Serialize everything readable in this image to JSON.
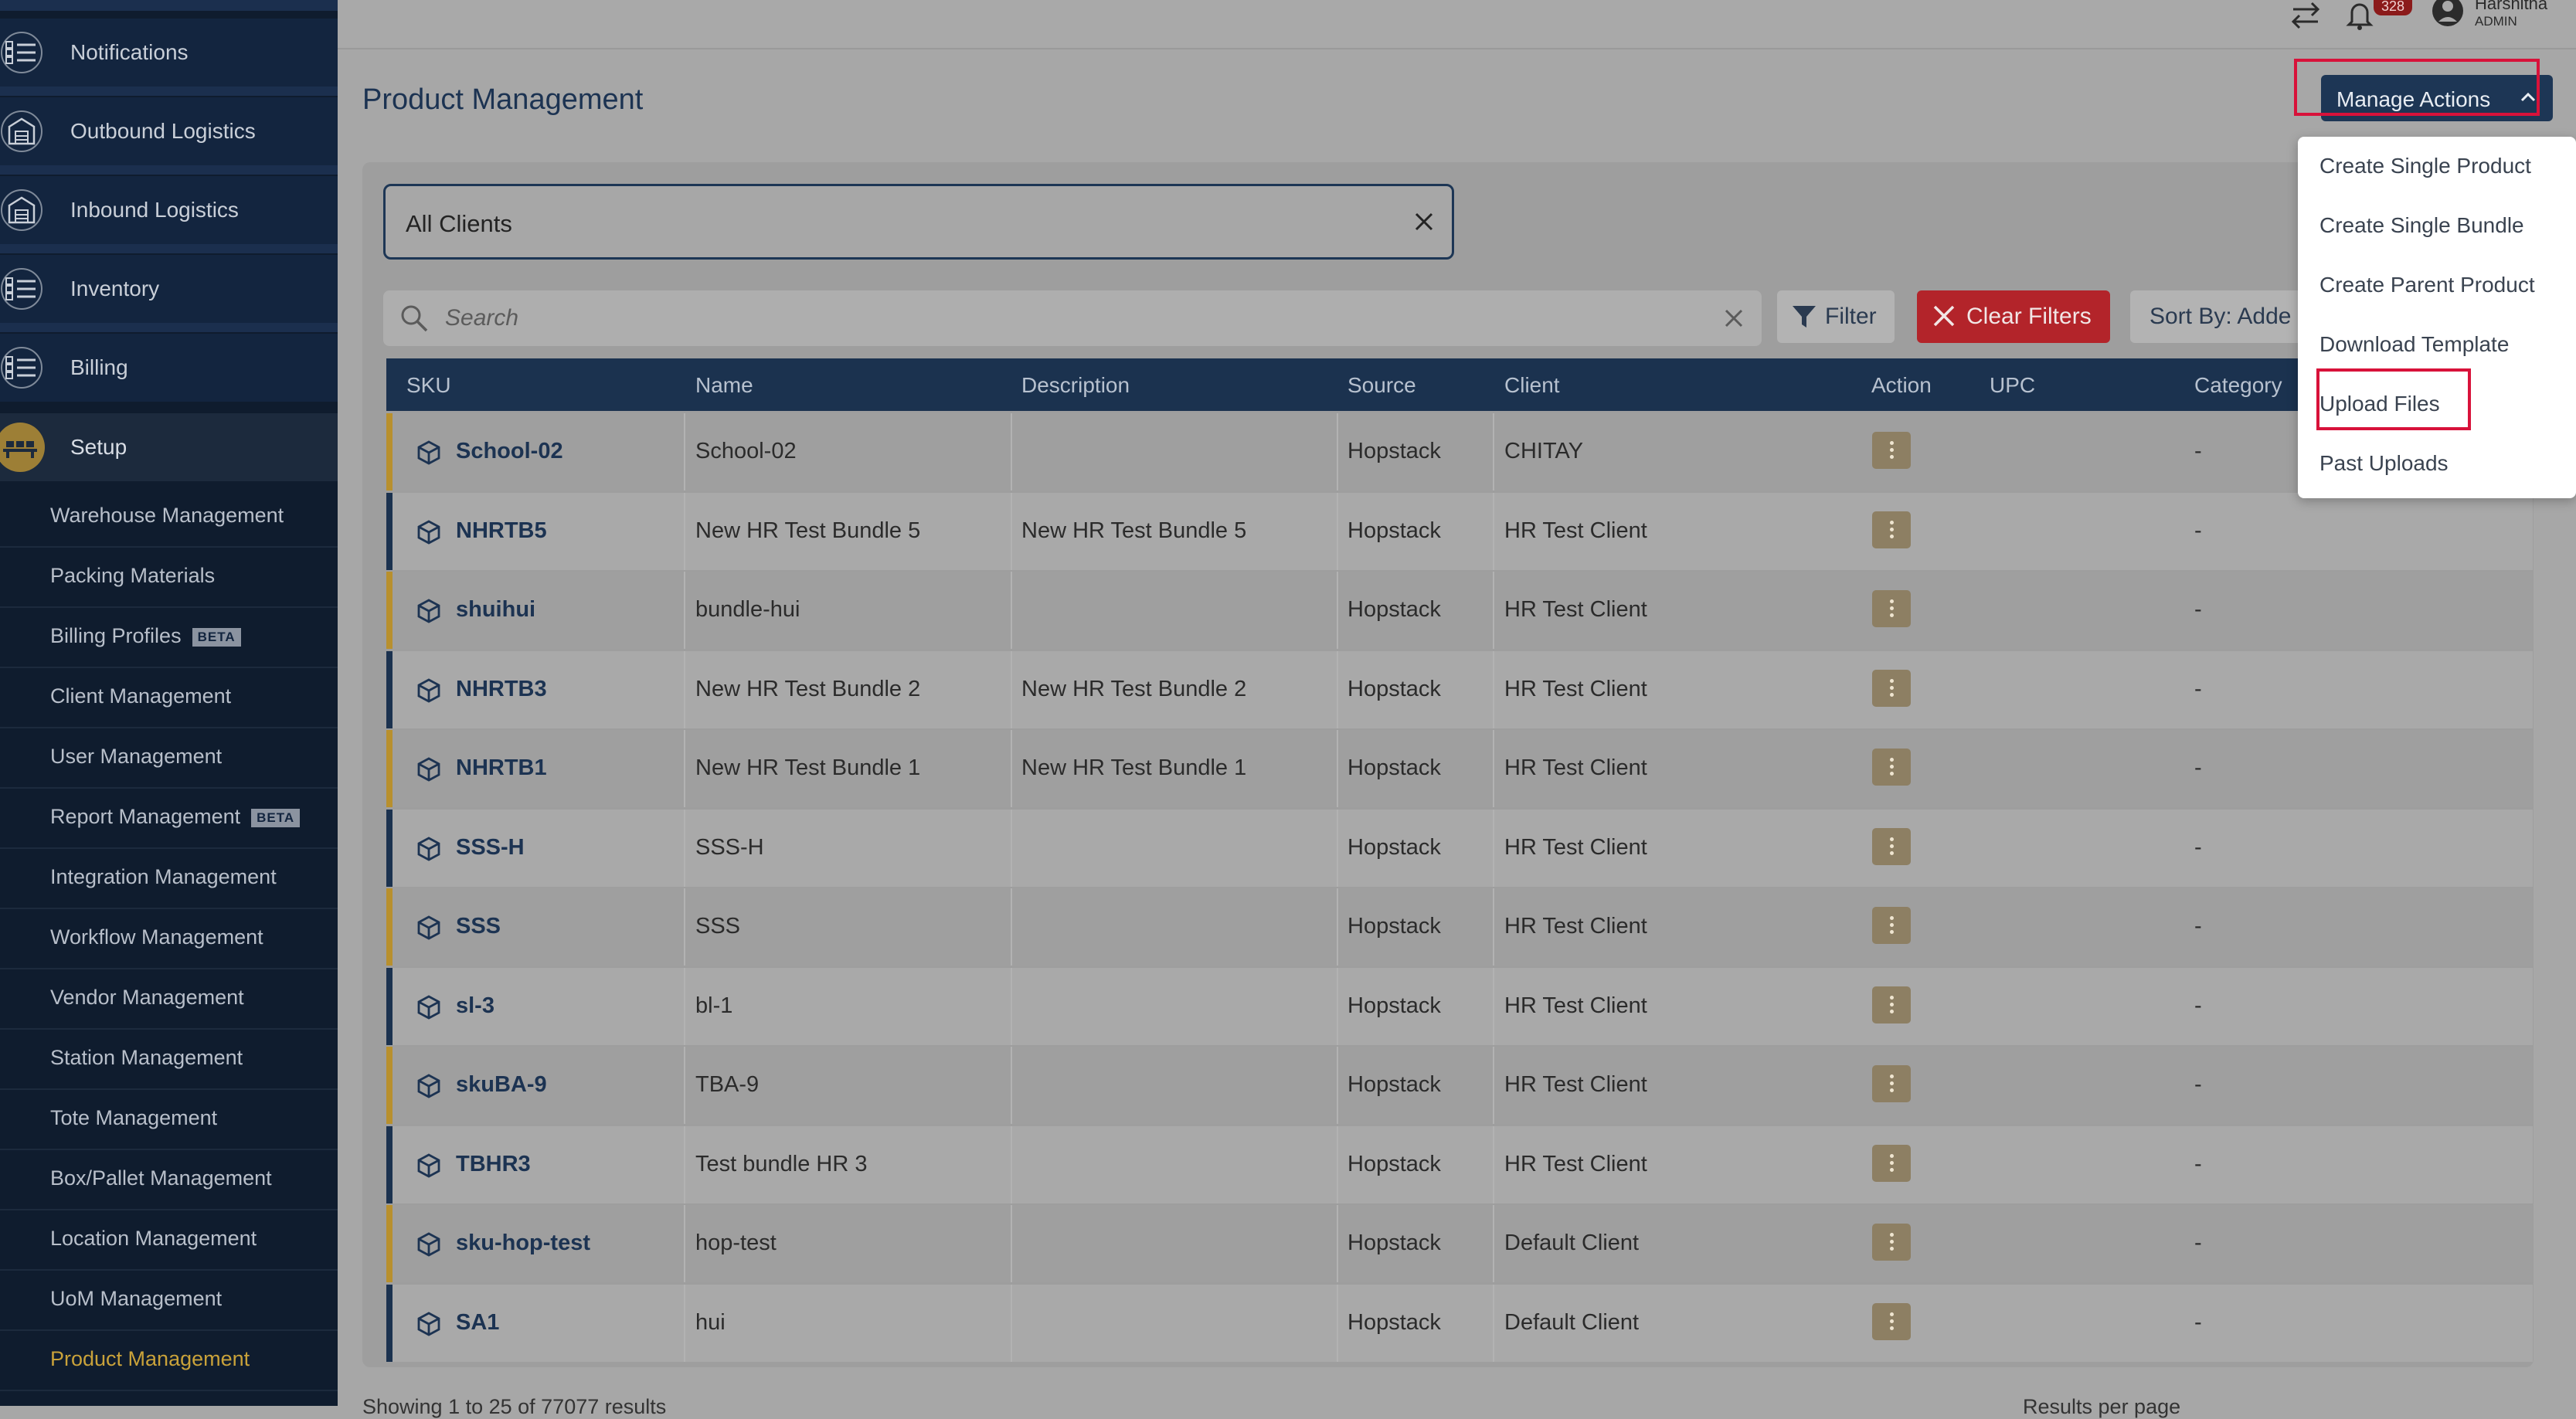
{
  "sidebar": {
    "nav": [
      {
        "label": "Notifications",
        "icon": "list-icon"
      },
      {
        "label": "Outbound Logistics",
        "icon": "warehouse-icon"
      },
      {
        "label": "Inbound Logistics",
        "icon": "warehouse-icon"
      },
      {
        "label": "Inventory",
        "icon": "list-icon"
      },
      {
        "label": "Billing",
        "icon": "list-icon"
      },
      {
        "label": "Setup",
        "icon": "setup-icon"
      }
    ],
    "setup_items": [
      {
        "label": "Warehouse Management"
      },
      {
        "label": "Packing Materials"
      },
      {
        "label": "Billing Profiles",
        "badge": "BETA"
      },
      {
        "label": "Client Management"
      },
      {
        "label": "User Management"
      },
      {
        "label": "Report Management",
        "badge": "BETA"
      },
      {
        "label": "Integration Management"
      },
      {
        "label": "Workflow Management"
      },
      {
        "label": "Vendor Management"
      },
      {
        "label": "Station Management"
      },
      {
        "label": "Tote Management"
      },
      {
        "label": "Box/Pallet Management"
      },
      {
        "label": "Location Management"
      },
      {
        "label": "UoM Management"
      },
      {
        "label": "Product Management"
      }
    ]
  },
  "topbar": {
    "notification_count": "328",
    "user_name": "Harshitha",
    "user_role": "ADMIN"
  },
  "page": {
    "title": "Product Management",
    "client_filter_value": "All Clients",
    "search_placeholder": "Search",
    "filter_label": "Filter",
    "clear_filters_label": "Clear Filters",
    "sort_label": "Sort By: Adde"
  },
  "manage_actions": {
    "label": "Manage Actions",
    "items": [
      "Create Single Product",
      "Create Single Bundle",
      "Create Parent Product",
      "Download Template",
      "Upload Files",
      "Past Uploads"
    ]
  },
  "table": {
    "columns": [
      "SKU",
      "Name",
      "Description",
      "Source",
      "Client",
      "Action",
      "UPC",
      "Category"
    ],
    "rows": [
      {
        "sku": "School-02",
        "name": "School-02",
        "description": "",
        "source": "Hopstack",
        "client": "CHITAY",
        "upc": "",
        "category": "-"
      },
      {
        "sku": "NHRTB5",
        "name": "New HR Test Bundle 5",
        "description": "New HR Test Bundle 5",
        "source": "Hopstack",
        "client": "HR Test Client",
        "upc": "",
        "category": "-"
      },
      {
        "sku": "shuihui",
        "name": "bundle-hui",
        "description": "",
        "source": "Hopstack",
        "client": "HR Test Client",
        "upc": "",
        "category": "-"
      },
      {
        "sku": "NHRTB3",
        "name": "New HR Test Bundle 2",
        "description": "New HR Test Bundle 2",
        "source": "Hopstack",
        "client": "HR Test Client",
        "upc": "",
        "category": "-"
      },
      {
        "sku": "NHRTB1",
        "name": "New HR Test Bundle 1",
        "description": "New HR Test Bundle 1",
        "source": "Hopstack",
        "client": "HR Test Client",
        "upc": "",
        "category": "-"
      },
      {
        "sku": "SSS-H",
        "name": "SSS-H",
        "description": "",
        "source": "Hopstack",
        "client": "HR Test Client",
        "upc": "",
        "category": "-"
      },
      {
        "sku": "SSS",
        "name": "SSS",
        "description": "",
        "source": "Hopstack",
        "client": "HR Test Client",
        "upc": "",
        "category": "-"
      },
      {
        "sku": "sl-3",
        "name": "bl-1",
        "description": "",
        "source": "Hopstack",
        "client": "HR Test Client",
        "upc": "",
        "category": "-"
      },
      {
        "sku": "skuBA-9",
        "name": "TBA-9",
        "description": "",
        "source": "Hopstack",
        "client": "HR Test Client",
        "upc": "",
        "category": "-"
      },
      {
        "sku": "TBHR3",
        "name": "Test bundle HR 3",
        "description": "",
        "source": "Hopstack",
        "client": "HR Test Client",
        "upc": "",
        "category": "-"
      },
      {
        "sku": "sku-hop-test",
        "name": "hop-test",
        "description": "",
        "source": "Hopstack",
        "client": "Default Client",
        "upc": "",
        "category": "-"
      },
      {
        "sku": "SA1",
        "name": "hui",
        "description": "",
        "source": "Hopstack",
        "client": "Default Client",
        "upc": "",
        "category": "-"
      }
    ]
  },
  "footer": {
    "results_text": "Showing 1 to 25 of 77077 results",
    "per_page_label": "Results per page"
  },
  "colors": {
    "accent_gold": "#c9a23a",
    "navy": "#1d3655",
    "danger": "#b3242a"
  }
}
